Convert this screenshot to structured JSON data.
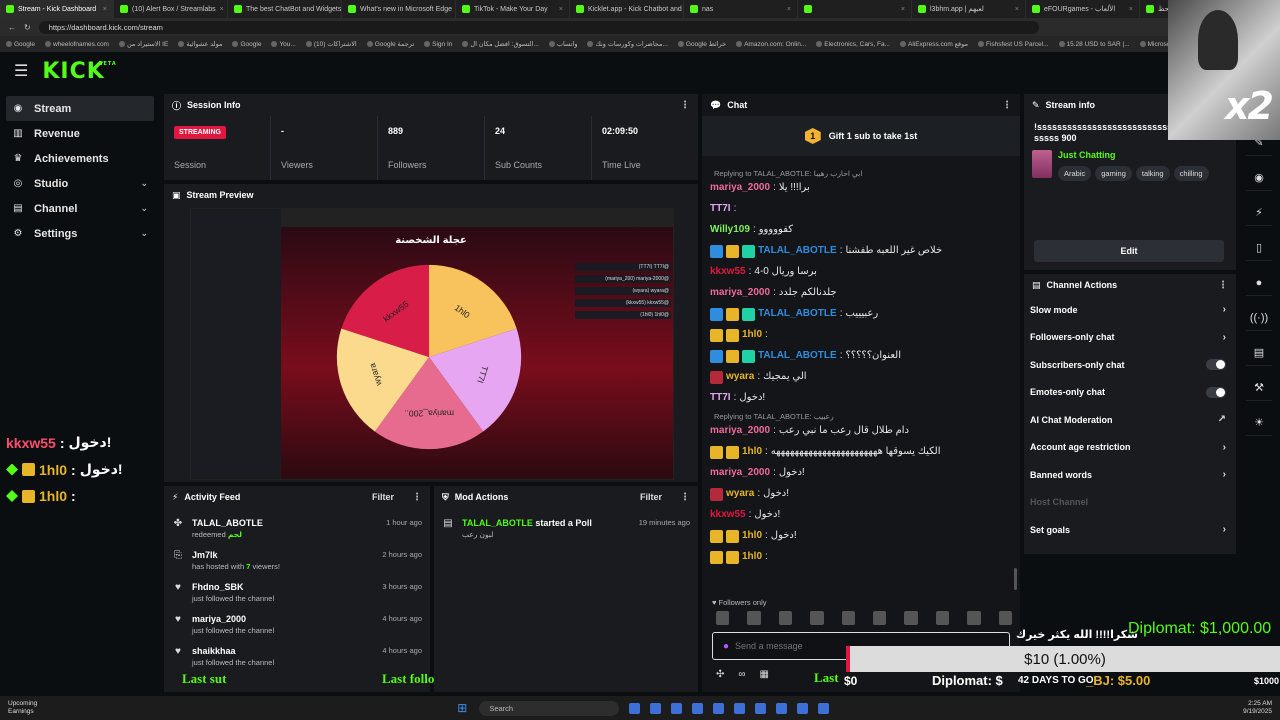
{
  "browser": {
    "tabs": [
      "Stream - Kick Dashboard",
      "(10) Alert Box / Streamlabs",
      "The best ChatBot and Widgets",
      "What's new in Microsoft Edge",
      "TikTok - Make Your Day",
      "Kicklet.app - Kick Chatbot and",
      "nas",
      "",
      "l3bhm.app | لعبهم",
      "eFOURgames - الألعاب",
      "كويت الحظ"
    ],
    "url": "https://dashboard.kick.com/stream",
    "bookmarks": [
      "Google",
      "wheelofnames.com",
      "الاستيراد من IE",
      "مولد عشوائية",
      "Google",
      "You...",
      "الاشتراكات (10)",
      "Google ترجمة",
      "Sign In",
      "التسوق: افضل مكان ال...",
      "واتساب",
      "محاضرات وكورسات ونك...",
      "Google خرائط",
      "Amazon.com: Onlin...",
      "Electronics, Cars, Fa...",
      "AliExpress.com موقع",
      "Fishsfest US Parcel...",
      "15.28 USD to SAR |...",
      "Microsoft Learning"
    ]
  },
  "nav": {
    "logo": "KICK",
    "logo_sup": "BETA",
    "items": [
      {
        "label": "Stream",
        "icon": "stream-icon",
        "chevron": false
      },
      {
        "label": "Revenue",
        "icon": "revenue-icon",
        "chevron": false
      },
      {
        "label": "Achievements",
        "icon": "trophy-icon",
        "chevron": false
      },
      {
        "label": "Studio",
        "icon": "studio-icon",
        "chevron": true
      },
      {
        "label": "Channel",
        "icon": "channel-icon",
        "chevron": true
      },
      {
        "label": "Settings",
        "icon": "gear-icon",
        "chevron": true
      }
    ]
  },
  "session": {
    "title": "Session Info",
    "status": "STREAMING",
    "status_label": "Session",
    "stats": [
      {
        "value": "-",
        "label": "Viewers"
      },
      {
        "value": "889",
        "label": "Followers"
      },
      {
        "value": "24",
        "label": "Sub Counts"
      },
      {
        "value": "02:09:50",
        "label": "Time Live"
      }
    ]
  },
  "preview": {
    "title": "Stream Preview",
    "wheel_title": "عجلة الشخصنة",
    "wheel_segments": [
      {
        "label": "1hl0",
        "color": "#f8c25c"
      },
      {
        "label": "TT7I",
        "color": "#e6a6f2"
      },
      {
        "label": "mariya_200..",
        "color": "#e76b8f"
      },
      {
        "label": "wyara",
        "color": "#fbd98d"
      },
      {
        "label": "kkxw55",
        "color": "#d81e48"
      }
    ],
    "right_entries": [
      "(TT7I) TT7I@",
      "(mariya_200) mariya-2000@",
      "(wyara) wyara@",
      "(kkxw55) kkxw55@",
      "(1hl0) 1hl0@"
    ]
  },
  "activity": {
    "title": "Activity Feed",
    "filter": "Filter",
    "items": [
      {
        "name": "TALAL_ABOTLE",
        "desc": "redeemed",
        "extra": "لحم",
        "time": "1 hour ago",
        "icon": "redeem-icon"
      },
      {
        "name": "Jm7lk",
        "desc": "has hosted with",
        "extra": "7",
        "desc2": "viewers!",
        "time": "2 hours ago",
        "icon": "host-icon"
      },
      {
        "name": "Fhdno_SBK",
        "desc": "just followed the channel",
        "time": "3 hours ago",
        "icon": "heart-icon"
      },
      {
        "name": "mariya_2000",
        "desc": "just followed the channel",
        "time": "4 hours ago",
        "icon": "heart-icon"
      },
      {
        "name": "shaikkhaa",
        "desc": "just followed the channel",
        "time": "4 hours ago",
        "icon": "heart-icon"
      }
    ]
  },
  "modactions": {
    "title": "Mod Actions",
    "filter": "Filter",
    "items": [
      {
        "name": "TALAL_ABOTLE",
        "action": "started a Poll",
        "sub": "لبون رعب",
        "time": "19 minutes ago"
      }
    ]
  },
  "chat": {
    "title": "Chat",
    "pin": "Gift 1 sub to take 1st",
    "pin_count": "1",
    "messages": [
      {
        "reply": "Replying to TALAL_ABOTLE: ابي احارب رهيبا"
      },
      {
        "user": "mariya_2000",
        "color": "#f06a9a",
        "text": "برا!!! يلا",
        "badges": []
      },
      {
        "user": "TT7I",
        "color": "#e6a6f2",
        "text": "",
        "badges": []
      },
      {
        "user": "Willy109",
        "color": "#7ef05f",
        "text": "كفووووو",
        "badges": []
      },
      {
        "user": "TALAL_ABOTLE",
        "color": "#2f8de0",
        "text": "خلاص غير اللعبه طفشنا",
        "badges": [
          "blue",
          "gold",
          "teal"
        ]
      },
      {
        "user": "kkxw55",
        "color": "#e0173e",
        "text": "برسا وريال 0-4",
        "badges": []
      },
      {
        "user": "mariya_2000",
        "color": "#f06a9a",
        "text": "جلدنالكم جلدد",
        "badges": []
      },
      {
        "user": "TALAL_ABOTLE",
        "color": "#2f8de0",
        "text": "رعبيييب",
        "badges": [
          "blue",
          "gold",
          "teal"
        ]
      },
      {
        "user": "1hl0",
        "color": "#e8b528",
        "text": "",
        "badges": [
          "gold",
          "gold"
        ]
      },
      {
        "user": "TALAL_ABOTLE",
        "color": "#2f8de0",
        "text": "العنوان؟؟؟؟؟",
        "badges": [
          "blue",
          "gold",
          "teal"
        ]
      },
      {
        "user": "wyara",
        "color": "#e8b528",
        "text": "الي يمجيك",
        "badges": [
          "red"
        ]
      },
      {
        "user": "TT7I",
        "color": "#e6a6f2",
        "text": "دخول!",
        "badges": []
      },
      {
        "reply": "Replying to TALAL_ABOTLE: رعبيب"
      },
      {
        "user": "mariya_2000",
        "color": "#f06a9a",
        "text": "دام طلال قال رعب ما نبي رعب",
        "badges": []
      },
      {
        "user": "1hl0",
        "color": "#e8b528",
        "text": "الكيك يسوقها هههههههههههههههههههههههه",
        "badges": [
          "gold",
          "gold"
        ]
      },
      {
        "user": "mariya_2000",
        "color": "#f06a9a",
        "text": "دخول!",
        "badges": []
      },
      {
        "user": "wyara",
        "color": "#e8b528",
        "text": "دخول!",
        "badges": [
          "red"
        ]
      },
      {
        "user": "kkxw55",
        "color": "#e0173e",
        "text": "دخول!",
        "badges": []
      },
      {
        "user": "1hl0",
        "color": "#e8b528",
        "text": "دخول!",
        "badges": [
          "gold",
          "gold"
        ]
      },
      {
        "user": "1hl0",
        "color": "#e8b528",
        "text": "",
        "badges": [
          "gold",
          "gold"
        ]
      }
    ],
    "followers_only": "Followers only",
    "placeholder": "Send a message"
  },
  "streaminfo": {
    "title": "Stream info",
    "stream_title": "!ssssssssssssssssssssssssssssssssssssssssss 900",
    "category": "Just Chatting",
    "tags": [
      "Arabic",
      "gaming",
      "talking",
      "chilling"
    ],
    "edit": "Edit"
  },
  "channelactions": {
    "title": "Channel Actions",
    "items": [
      {
        "label": "Slow mode",
        "type": "chevron"
      },
      {
        "label": "Followers-only chat",
        "type": "chevron"
      },
      {
        "label": "Subscribers-only chat",
        "type": "toggle"
      },
      {
        "label": "Emotes-only chat",
        "type": "toggle"
      },
      {
        "label": "AI Chat Moderation",
        "type": "external"
      },
      {
        "label": "Account age restriction",
        "type": "chevron"
      },
      {
        "label": "Banned words",
        "type": "chevron"
      },
      {
        "label": "Host Channel",
        "type": "disabled"
      },
      {
        "label": "Set goals",
        "type": "chevron"
      }
    ]
  },
  "overlay": {
    "left": [
      {
        "name": "kkxw55",
        "text": "دخول!",
        "color": "red"
      },
      {
        "name": "1hl0",
        "text": "دخول!",
        "color": "gold"
      },
      {
        "name": "1hl0",
        "text": "",
        "color": "gold"
      }
    ],
    "diplomat": "Diplomat: $1,000.00",
    "arabic": "شكرا!!!! الله يكثر خيرك",
    "goal": "$10 (1.00%)",
    "last_sub": "Last sut",
    "last_follow": "Last follo",
    "last_r": "Last",
    "days": "42 DAYS TO GO",
    "bj": "_BJ: $5.00",
    "dipl2": "Diplomat: $",
    "dollar0": "$0",
    "k1000": "$1000",
    "x2": "x2"
  },
  "taskbar": {
    "weather": "Upcoming",
    "weather2": "Earnings",
    "search": "Search",
    "time": "2:25 AM",
    "date": "9/19/2025"
  }
}
